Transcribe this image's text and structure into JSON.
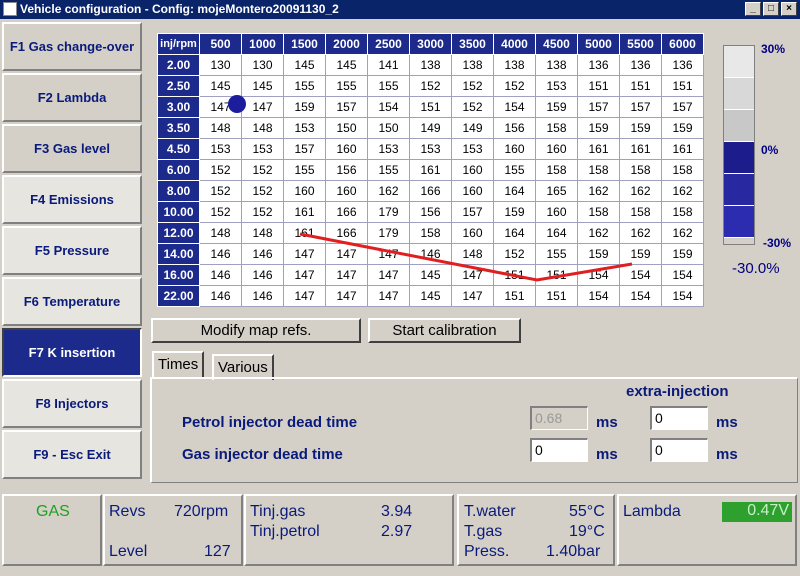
{
  "window": {
    "title": "Vehicle configuration - Config: mojeMontero20091130_2",
    "minimize": "_",
    "maximize": "□",
    "close": "×"
  },
  "nav": [
    {
      "label": "F1 Gas change-over",
      "active": false
    },
    {
      "label": "F2 Lambda",
      "active": false
    },
    {
      "label": "F3 Gas level",
      "active": false
    },
    {
      "label": "F4 Emissions",
      "active": false
    },
    {
      "label": "F5 Pressure",
      "active": false
    },
    {
      "label": "F6 Temperature",
      "active": false
    },
    {
      "label": "F7 K insertion",
      "active": true
    },
    {
      "label": "F8 Injectors",
      "active": false
    },
    {
      "label": "F9 - Esc Exit",
      "active": false
    }
  ],
  "map": {
    "corner": "inj/rpm",
    "rpm": [
      "500",
      "1000",
      "1500",
      "2000",
      "2500",
      "3000",
      "3500",
      "4000",
      "4500",
      "5000",
      "5500",
      "6000"
    ],
    "rows": [
      {
        "inj": "2.00",
        "values": [
          "130",
          "130",
          "145",
          "145",
          "141",
          "138",
          "138",
          "138",
          "138",
          "136",
          "136",
          "136"
        ]
      },
      {
        "inj": "2.50",
        "values": [
          "145",
          "145",
          "155",
          "155",
          "155",
          "152",
          "152",
          "152",
          "153",
          "151",
          "151",
          "151"
        ]
      },
      {
        "inj": "3.00",
        "values": [
          "147",
          "147",
          "159",
          "157",
          "154",
          "151",
          "152",
          "154",
          "159",
          "157",
          "157",
          "157"
        ]
      },
      {
        "inj": "3.50",
        "values": [
          "148",
          "148",
          "153",
          "150",
          "150",
          "149",
          "149",
          "156",
          "158",
          "159",
          "159",
          "159"
        ]
      },
      {
        "inj": "4.50",
        "values": [
          "153",
          "153",
          "157",
          "160",
          "153",
          "153",
          "153",
          "160",
          "160",
          "161",
          "161",
          "161"
        ]
      },
      {
        "inj": "6.00",
        "values": [
          "152",
          "152",
          "155",
          "156",
          "155",
          "161",
          "160",
          "155",
          "158",
          "158",
          "158",
          "158"
        ]
      },
      {
        "inj": "8.00",
        "values": [
          "152",
          "152",
          "160",
          "160",
          "162",
          "166",
          "160",
          "164",
          "165",
          "162",
          "162",
          "162"
        ]
      },
      {
        "inj": "10.00",
        "values": [
          "152",
          "152",
          "161",
          "166",
          "179",
          "156",
          "157",
          "159",
          "160",
          "158",
          "158",
          "158"
        ]
      },
      {
        "inj": "12.00",
        "values": [
          "148",
          "148",
          "161",
          "166",
          "179",
          "158",
          "160",
          "164",
          "164",
          "162",
          "162",
          "162"
        ]
      },
      {
        "inj": "14.00",
        "values": [
          "146",
          "146",
          "147",
          "147",
          "147",
          "146",
          "148",
          "152",
          "155",
          "159",
          "159",
          "159"
        ]
      },
      {
        "inj": "16.00",
        "values": [
          "146",
          "146",
          "147",
          "147",
          "147",
          "145",
          "147",
          "151",
          "151",
          "154",
          "154",
          "154"
        ]
      },
      {
        "inj": "22.00",
        "values": [
          "146",
          "146",
          "147",
          "147",
          "147",
          "145",
          "147",
          "151",
          "151",
          "154",
          "154",
          "154"
        ]
      }
    ]
  },
  "scale": {
    "top_label": "30%",
    "mid_label": "0%",
    "bottom_label": "-30%",
    "current": "-30.0%",
    "segments": [
      "#e8e8e8",
      "#d8d8d8",
      "#c8c8c8",
      "#1c1c8c",
      "#2828a0",
      "#2c2cb0"
    ]
  },
  "buttons": {
    "modify_map": "Modify map refs.",
    "start_calibration": "Start calibration"
  },
  "tabs": {
    "times": "Times",
    "various": "Various"
  },
  "times": {
    "extra_injection": "extra-injection",
    "petrol_label": "Petrol injector dead time",
    "gas_label": "Gas injector dead time",
    "petrol_value": "0.68",
    "petrol_extra": "0",
    "gas_value": "0",
    "gas_extra": "0",
    "unit": "ms"
  },
  "status": {
    "fuel": "GAS",
    "revs_label": "Revs",
    "revs_value": "720rpm",
    "level_label": "Level",
    "level_value": "127",
    "tinj_gas_label": "Tinj.gas",
    "tinj_gas_value": "3.94",
    "tinj_petrol_label": "Tinj.petrol",
    "tinj_petrol_value": "2.97",
    "twater_label": "T.water",
    "twater_value": "55°C",
    "tgas_label": "T.gas",
    "tgas_value": "19°C",
    "press_label": "Press.",
    "press_value": "1.40bar",
    "lambda_label": "Lambda",
    "lambda_value": "0.47V"
  },
  "colors": {
    "accent": "#1c2a8c",
    "title_bar": "#0a246a",
    "gas_text": "#20a020",
    "lambda_bg": "#2ea02e",
    "trace": "#e02020"
  }
}
